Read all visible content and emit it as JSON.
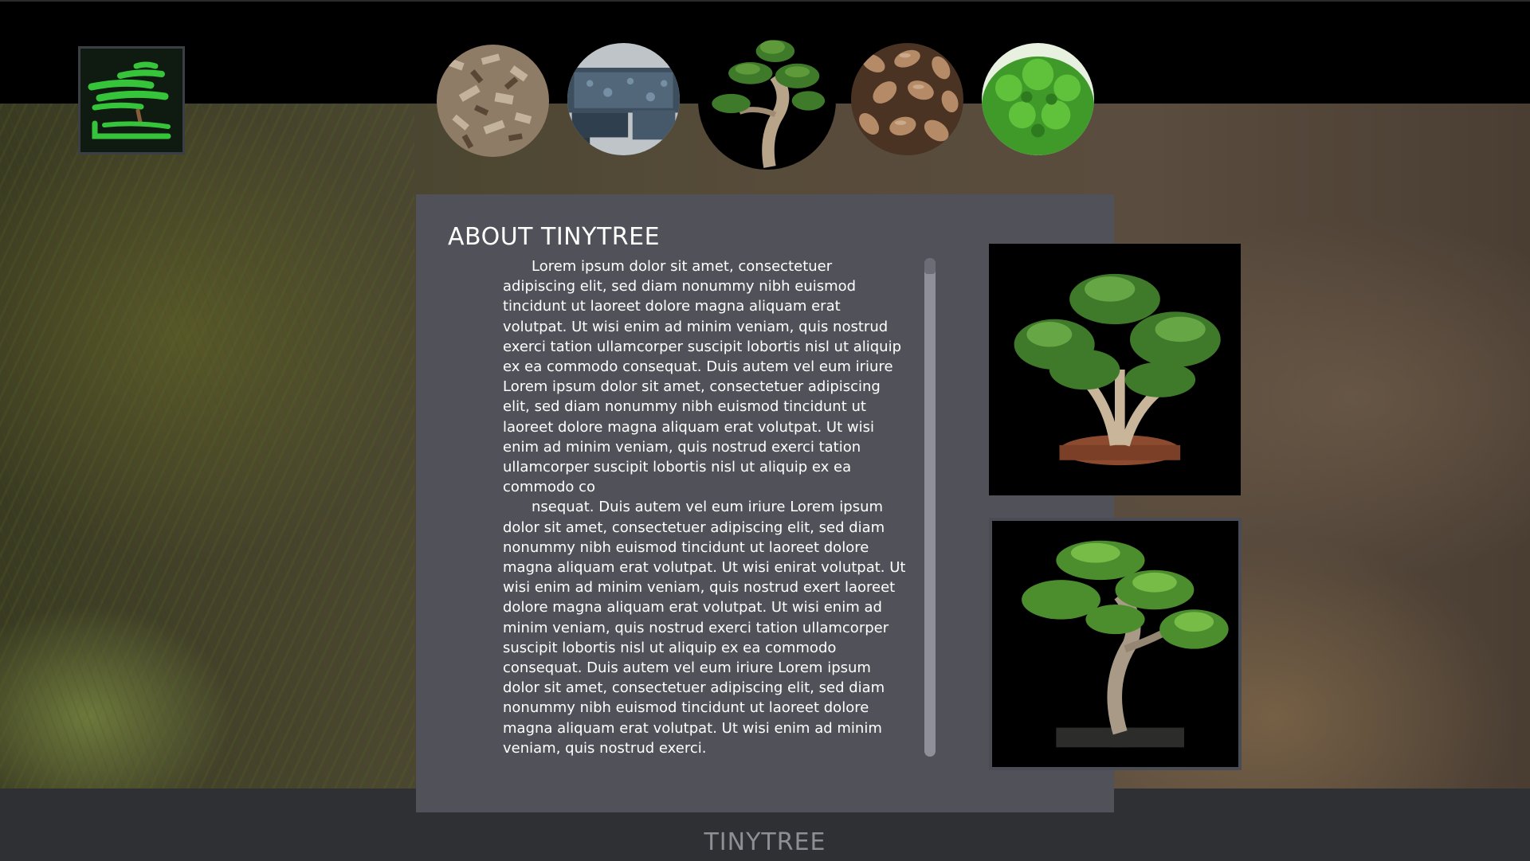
{
  "header": {
    "logo": {
      "name": "tinytree-logo",
      "accent": "#35c43a"
    },
    "nav": [
      {
        "name": "wood-chips",
        "label": ""
      },
      {
        "name": "bonsai-pots",
        "label": ""
      },
      {
        "name": "bonsai-tree",
        "label": ""
      },
      {
        "name": "seeds",
        "label": ""
      },
      {
        "name": "green-shrub",
        "label": ""
      }
    ]
  },
  "about": {
    "title": "ABOUT TINYTREE",
    "paragraphs": [
      "Lorem ipsum dolor sit amet, consectetuer adipiscing elit, sed diam nonummy nibh euismod tincidunt ut laoreet dolore magna aliquam erat volutpat. Ut wisi enim ad minim veniam, quis nostrud exerci tation ullamcorper suscipit lobortis nisl ut aliquip ex ea commodo consequat. Duis autem vel eum iriure Lorem ipsum dolor sit amet, consectetuer adipiscing elit, sed diam nonummy nibh euismod tincidunt ut laoreet dolore magna aliquam erat volutpat. Ut wisi enim ad minim veniam, quis nostrud exerci tation ullamcorper suscipit lobortis nisl ut aliquip ex ea commodo co",
      "nsequat. Duis autem vel eum iriure Lorem ipsum dolor sit amet, consectetuer adipiscing elit, sed diam nonummy nibh euismod tincidunt ut laoreet dolore magna aliquam erat volutpat. Ut wisi enirat volutpat. Ut wisi enim ad minim veniam, quis nostrud exert laoreet dolore magna aliquam erat volutpat. Ut wisi enim ad minim veniam, quis nostrud exerci tation ullamcorper suscipit lobortis nisl ut aliquip ex ea commodo consequat. Duis autem vel eum iriure Lorem ipsum dolor sit amet, consectetuer adipiscing elit, sed diam nonummy nibh euismod tincidunt ut laoreet dolore magna aliquam erat volutpat. Ut wisi enim ad minim veniam, quis nostrud exerci."
    ],
    "photos": [
      "bonsai-photo-1",
      "bonsai-photo-2"
    ]
  },
  "footer": {
    "title": "TINYTREE"
  },
  "colors": {
    "panel": "#515159",
    "topbar": "#000000",
    "footer": "#2e3033",
    "scrollbar": "#8e8f99"
  }
}
